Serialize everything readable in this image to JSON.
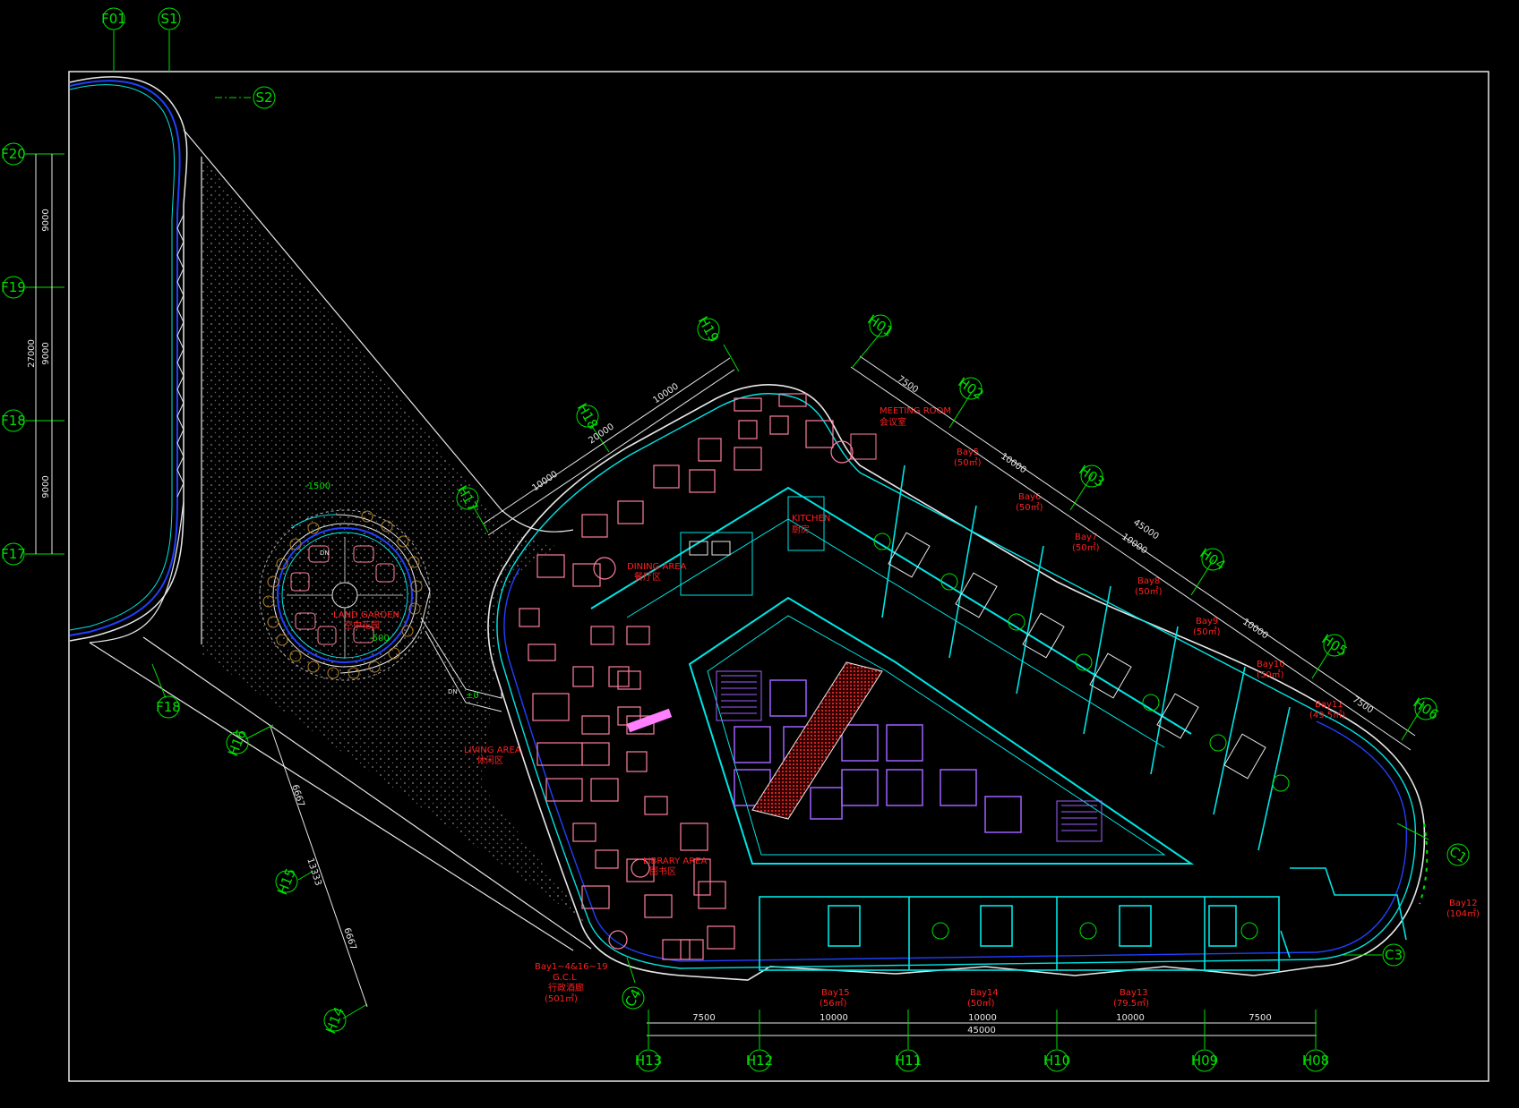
{
  "colors": {
    "background": "#000000",
    "grid": "#00e000",
    "wall": "#00e5e5",
    "furniture": "#ff7fa0",
    "label": "#ff2020",
    "stair": "#a060ff",
    "outline": "#e8e8e8",
    "blue": "#2040ff",
    "hatch": "#b0b0b0"
  },
  "grid_bubbles": {
    "f01": "F01",
    "s1": "S1",
    "s2": "S2",
    "f20": "F20",
    "f19": "F19",
    "f18": "F18",
    "f17": "F17",
    "f18b": "F18",
    "h16": "H16",
    "h15": "H15",
    "h14": "H14",
    "h17": "H17",
    "h18": "H18",
    "h19": "H19",
    "h01": "H01",
    "h02": "H02",
    "h03": "H03",
    "h04": "H04",
    "h05": "H05",
    "h06": "H06",
    "c1": "C1",
    "c3": "C3",
    "c4": "C4",
    "h13": "H13",
    "h12": "H12",
    "h11": "H11",
    "h10": "H10",
    "h09": "H09",
    "h08": "H08"
  },
  "dimensions": {
    "left_total": "27000",
    "left_a": "9000",
    "left_b": "9000",
    "left_c": "9000",
    "bottom_a": "7500",
    "bottom_b": "10000",
    "bottom_c": "10000",
    "bottom_d": "10000",
    "bottom_e": "7500",
    "bottom_total": "45000",
    "nw_total": "20000",
    "nw_a": "10000",
    "nw_b": "10000",
    "ne_total": "45000",
    "ne_a": "7500",
    "ne_b": "10000",
    "ne_c": "10000",
    "ne_d": "10000",
    "ne_e": "7500",
    "sw_a": "6667",
    "sw_b": "13333",
    "sw_c": "6667"
  },
  "levels": {
    "garden_top": "-1500",
    "garden_mid": "-500",
    "ramp": "±0",
    "dn1": "DN",
    "dn2": "DN",
    "inner": "±0"
  },
  "rooms": {
    "meeting_en": "MEETING ROOM",
    "meeting_cn": "会议室",
    "kitchen_en": "KITCHEN",
    "kitchen_cn": "厨房",
    "dining_en": "DINING AREA",
    "dining_cn": "餐厅区",
    "garden_en": "LAND GARDEN",
    "garden_cn": "空中花园",
    "living_en": "LIVING AREA",
    "living_cn": "休闲区",
    "library_en": "LIBRARY AREA",
    "library_cn": "图书区"
  },
  "bays": {
    "bay5": "Bay5",
    "bay5_area": "(50㎡)",
    "bay6": "Bay6",
    "bay6_area": "(50㎡)",
    "bay7": "Bay7",
    "bay7_area": "(50㎡)",
    "bay8": "Bay8",
    "bay8_area": "(50㎡)",
    "bay9": "Bay9",
    "bay9_area": "(50㎡)",
    "bay10": "Bay10",
    "bay10_area": "(50㎡)",
    "bay11": "Bay11",
    "bay11_area": "(49.5㎡)",
    "bay12": "Bay12",
    "bay12_area": "(104㎡)",
    "bay13": "Bay13",
    "bay13_area": "(79.5㎡)",
    "bay14": "Bay14",
    "bay14_area": "(50㎡)",
    "bay15": "Bay15",
    "bay15_area": "(56㎡)",
    "gcl_1": "Bay1~4&16~19",
    "gcl_2": "G.C.L",
    "gcl_3": "行政酒廊",
    "gcl_4": "(501㎡)"
  }
}
